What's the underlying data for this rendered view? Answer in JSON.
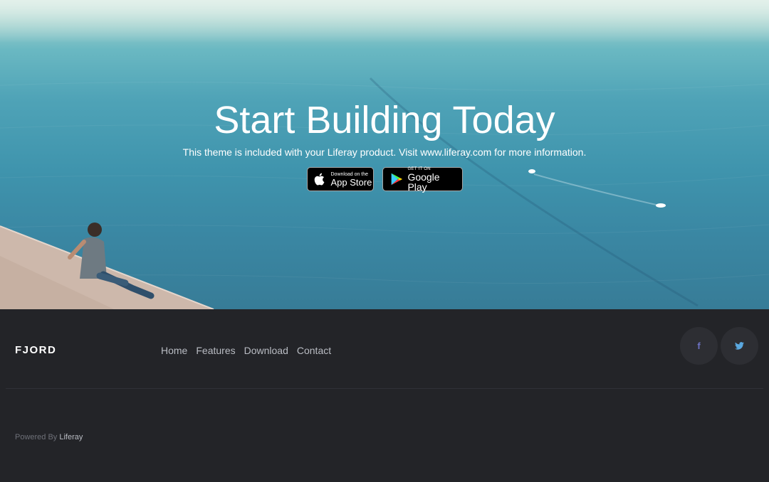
{
  "hero": {
    "title": "Start Building Today",
    "subtitle": "This theme is included with your Liferay product. Visit www.liferay.com for more information.",
    "app_store": {
      "small": "Download on the",
      "big": "App Store",
      "icon": "apple-icon"
    },
    "google_play": {
      "small": "GET IT ON",
      "big": "Google Play",
      "icon": "google-play-icon"
    }
  },
  "footer": {
    "brand": "FJORD",
    "nav": [
      "Home",
      "Features",
      "Download",
      "Contact"
    ],
    "social": [
      {
        "name": "facebook",
        "glyph": "f",
        "icon": "facebook-icon",
        "color": "#6d72c4"
      },
      {
        "name": "twitter",
        "icon": "twitter-icon",
        "color": "#5aa8e0"
      }
    ],
    "powered_prefix": "Powered By",
    "powered_link": "Liferay"
  },
  "colors": {
    "footer_bg": "#232428",
    "social_bg": "#2d2e33",
    "sea": "#3f94ad"
  }
}
